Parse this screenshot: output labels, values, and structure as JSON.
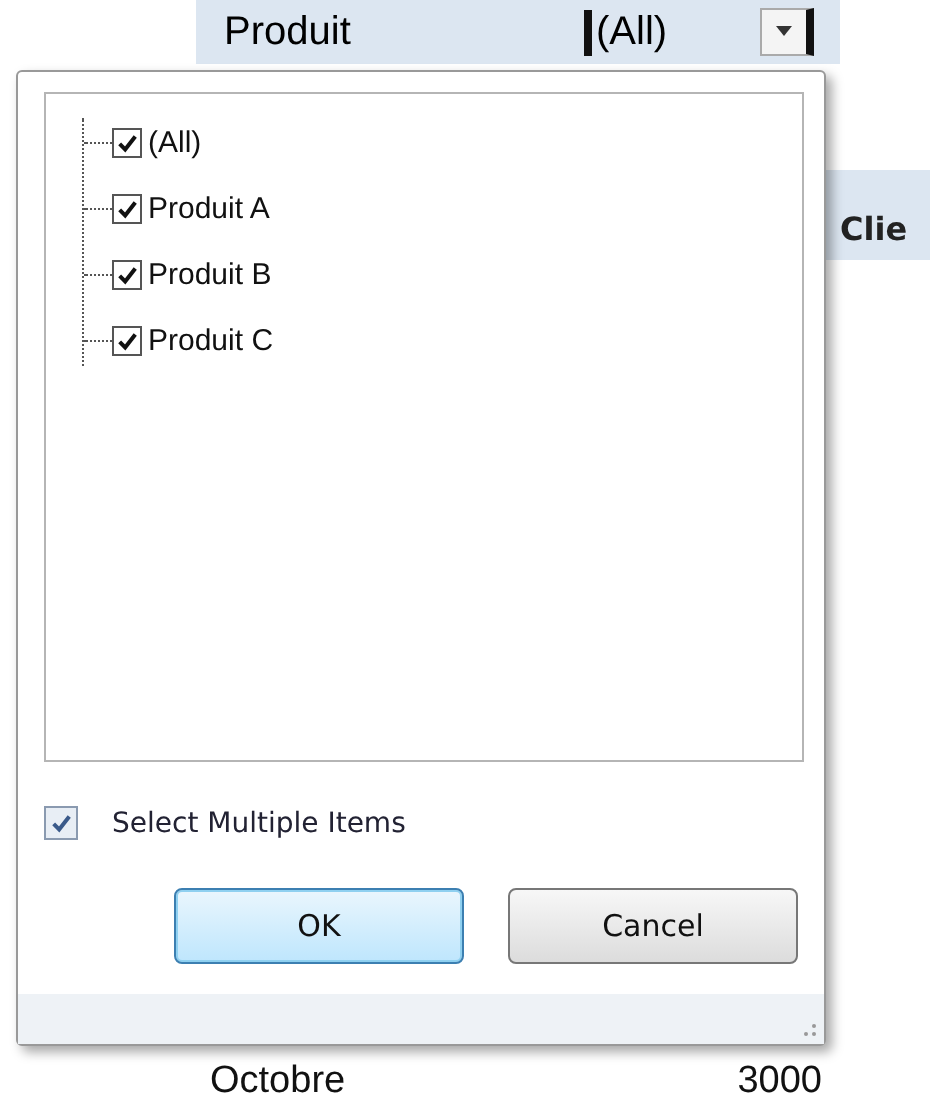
{
  "sheet": {
    "filter_label": "Produit",
    "filter_value": "(All)",
    "header_cell": "Clie",
    "rows": [
      {
        "month": "Octobre",
        "value": "3000"
      }
    ]
  },
  "popup": {
    "items": [
      {
        "label": "(All)",
        "checked": true
      },
      {
        "label": "Produit A",
        "checked": true
      },
      {
        "label": "Produit B",
        "checked": true
      },
      {
        "label": "Produit C",
        "checked": true
      }
    ],
    "select_multiple": {
      "label": "Select Multiple Items",
      "checked": true
    },
    "buttons": [
      {
        "label": "OK",
        "default": true
      },
      {
        "label": "Cancel",
        "default": false
      }
    ]
  }
}
